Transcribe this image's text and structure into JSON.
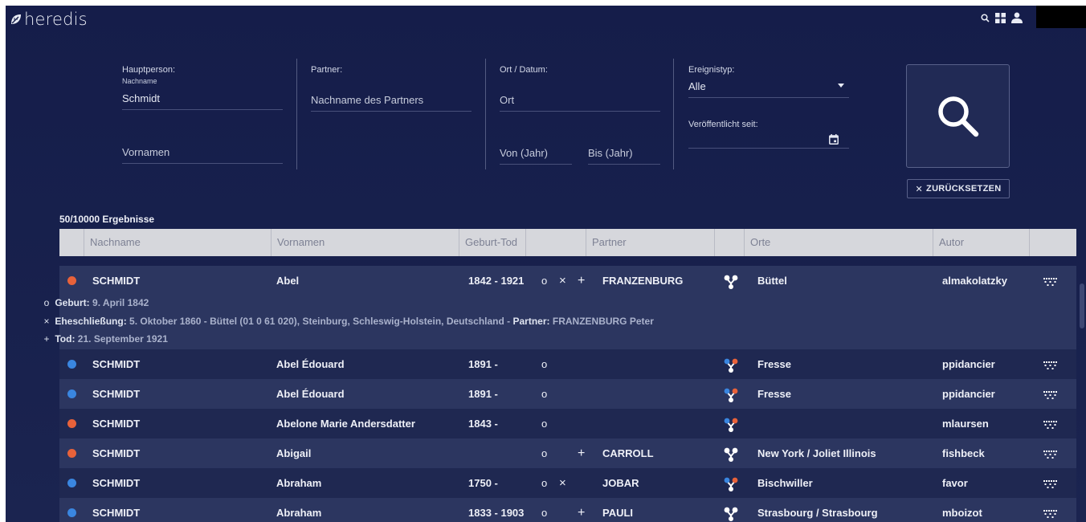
{
  "app": {
    "logo_text": "heredis"
  },
  "colors": {
    "male": "#3a86e0",
    "female": "#e8623a",
    "background": "#18214d"
  },
  "form": {
    "hauptperson_label": "Hauptperson:",
    "nachname_sublabel": "Nachname",
    "nachname_value": "Schmidt",
    "vornamen_placeholder": "Vornamen",
    "partner_label": "Partner:",
    "partner_placeholder": "Nachname des Partners",
    "ort_datum_label": "Ort / Datum:",
    "ort_placeholder": "Ort",
    "von_placeholder": "Von (Jahr)",
    "bis_placeholder": "Bis (Jahr)",
    "ereignistyp_label": "Ereignistyp:",
    "ereignistyp_value": "Alle",
    "veroeffentlicht_label": "Veröffentlicht seit:",
    "reset_label": "ZURÜCKSETZEN"
  },
  "results_count": "50/10000 Ergebnisse",
  "table": {
    "headers": {
      "nachname": "Nachname",
      "vornamen": "Vornamen",
      "geburt_tod": "Geburt-Tod",
      "partner": "Partner",
      "orte": "Orte",
      "autor": "Autor"
    },
    "rows": [
      {
        "gender": "female",
        "nachname": "SCHMIDT",
        "vornamen": "Abel",
        "dates": "1842 - 1921",
        "birth": "o",
        "marriage": "×",
        "death": "+",
        "partner": "FRANZENBURG",
        "tree": "white",
        "orte": "Büttel",
        "autor": "almakolatzky"
      },
      {
        "gender": "male",
        "nachname": "SCHMIDT",
        "vornamen": "Abel Édouard",
        "dates": "1891 -",
        "birth": "o",
        "marriage": "",
        "death": "",
        "partner": "",
        "tree": "colored",
        "orte": "Fresse",
        "autor": "ppidancier"
      },
      {
        "gender": "male",
        "nachname": "SCHMIDT",
        "vornamen": "Abel Édouard",
        "dates": "1891 -",
        "birth": "o",
        "marriage": "",
        "death": "",
        "partner": "",
        "tree": "colored",
        "orte": "Fresse",
        "autor": "ppidancier"
      },
      {
        "gender": "female",
        "nachname": "SCHMIDT",
        "vornamen": "Abelone Marie Andersdatter",
        "dates": "1843 -",
        "birth": "o",
        "marriage": "",
        "death": "",
        "partner": "",
        "tree": "colored",
        "orte": "",
        "autor": "mlaursen"
      },
      {
        "gender": "female",
        "nachname": "SCHMIDT",
        "vornamen": "Abigail",
        "dates": "",
        "birth": "o",
        "marriage": "",
        "death": "+",
        "partner": "CARROLL",
        "tree": "white",
        "orte": "New York / Joliet Illinois",
        "autor": "fishbeck"
      },
      {
        "gender": "male",
        "nachname": "SCHMIDT",
        "vornamen": "Abraham",
        "dates": "1750 -",
        "birth": "o",
        "marriage": "×",
        "death": "",
        "partner": "JOBAR",
        "tree": "colored",
        "orte": "Bischwiller",
        "autor": "favor"
      },
      {
        "gender": "male",
        "nachname": "SCHMIDT",
        "vornamen": "Abraham",
        "dates": "1833 - 1903",
        "birth": "o",
        "marriage": "",
        "death": "+",
        "partner": "PAULI",
        "tree": "white",
        "orte": "Strasbourg / Strasbourg",
        "autor": "mboizot"
      }
    ]
  },
  "detail": {
    "geburt_label": "Geburt:",
    "geburt_value": "9. April 1842",
    "ehe_label": "Eheschließung:",
    "ehe_value": "5. Oktober 1860 - Büttel (01 0 61 020), Steinburg, Schleswig-Holstein, Deutschland -",
    "partner_label": "Partner:",
    "partner_value": "FRANZENBURG Peter",
    "tod_label": "Tod:",
    "tod_value": "21. September 1921"
  }
}
